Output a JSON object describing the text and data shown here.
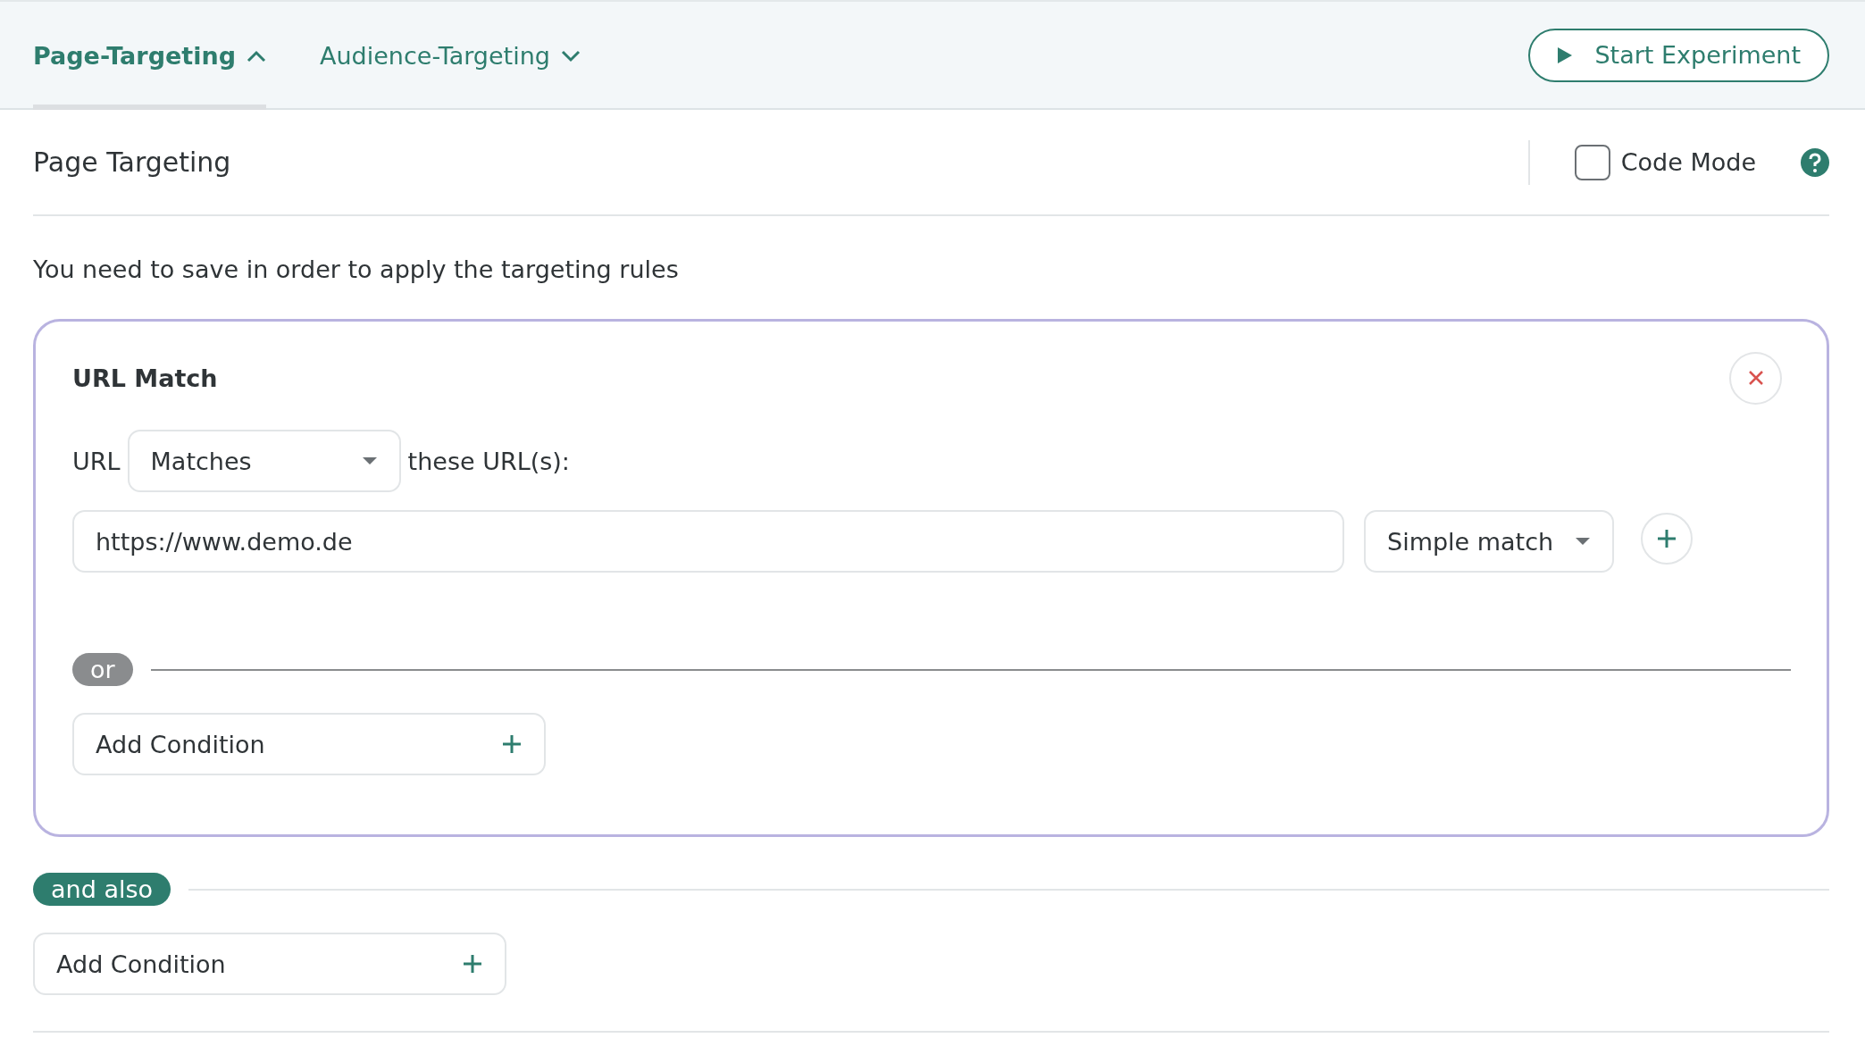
{
  "tabs": [
    {
      "label": "Page-Targeting",
      "selected": true,
      "expanded": true
    },
    {
      "label": "Audience-Targeting",
      "selected": false,
      "expanded": false
    }
  ],
  "start_button": "Start Experiment",
  "section": {
    "title": "Page Targeting",
    "code_mode": {
      "label": "Code Mode",
      "checked": false
    }
  },
  "notice": "You need to save in order to apply the targeting rules",
  "rule_card": {
    "title": "URL Match",
    "url_label": "URL",
    "operator": "Matches",
    "operator_suffix": "these URL(s):",
    "urls": [
      {
        "value": "https://www.demo.de",
        "match_type": "Simple match"
      }
    ],
    "or_label": "or",
    "add_condition": "Add Condition"
  },
  "and_label": "and also",
  "add_condition": "Add Condition"
}
